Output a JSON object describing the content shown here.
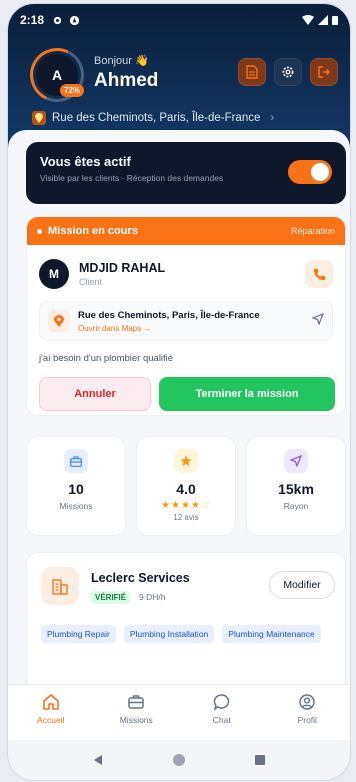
{
  "status_bar": {
    "time": "2:18"
  },
  "header": {
    "avatar_initial": "A",
    "avatar_badge": "72%",
    "greeting": "Bonjour 👋",
    "name": "Ahmed",
    "address": "Rue des Cheminots, Paris, Île-de-France",
    "icons": [
      "document-icon",
      "gear-icon",
      "logout-icon"
    ]
  },
  "active": {
    "title": "Vous êtes actif",
    "subtitle": "Visible par les clients · Réception des demandes",
    "toggle_on": true
  },
  "mission": {
    "header_label": "Mission en cours",
    "tag": "Réparation",
    "client_initial": "M",
    "client_name": "MDJID RAHAL",
    "client_role": "Client",
    "address": "Rue des Cheminots, Paris, Île-de-France",
    "maps_link": "Ouvrir dans Maps →",
    "description": "j'ai besoin d'un plombier qualifié",
    "cancel_label": "Annuler",
    "finish_label": "Terminer la mission"
  },
  "stats": [
    {
      "icon": "briefcase-icon",
      "value": "10",
      "label": "Missions"
    },
    {
      "icon": "star-icon",
      "value": "4.0",
      "stars": "★★★★",
      "stars_empty": "☆",
      "label": "12 avis"
    },
    {
      "icon": "navigation-icon",
      "value": "15km",
      "label": "Rayon"
    }
  ],
  "business": {
    "name": "Leclerc Services",
    "verified": "VÉRIFIÉ",
    "rate": "9 DH/h",
    "modify_label": "Modifier",
    "chips": [
      "Plumbing Repair",
      "Plumbing Installation",
      "Plumbing Maintenance"
    ]
  },
  "nav": [
    {
      "label": "Accueil",
      "icon": "home-icon",
      "active": true
    },
    {
      "label": "Missions",
      "icon": "briefcase-icon",
      "active": false
    },
    {
      "label": "Chat",
      "icon": "chat-icon",
      "active": false
    },
    {
      "label": "Profil",
      "icon": "profile-icon",
      "active": false
    }
  ],
  "colors": {
    "accent": "#f97316",
    "success": "#22c55e",
    "danger": "#dc2626",
    "header": "#0b1e3a"
  }
}
